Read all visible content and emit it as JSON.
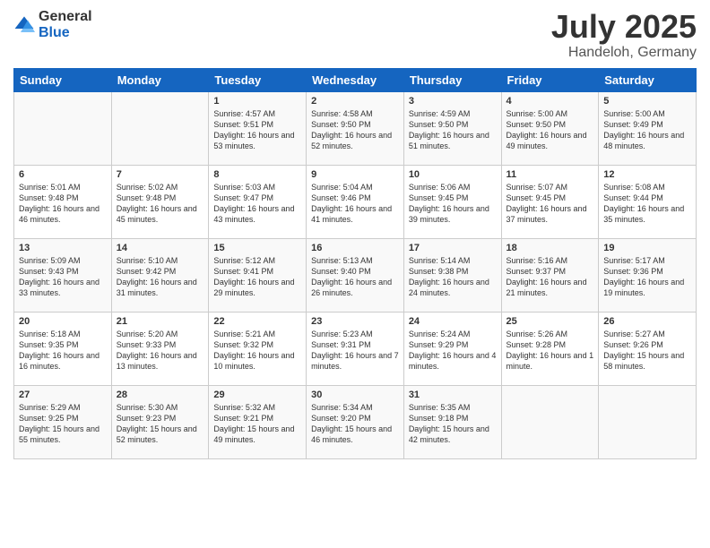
{
  "logo": {
    "general": "General",
    "blue": "Blue"
  },
  "title": "July 2025",
  "location": "Handeloh, Germany",
  "days": [
    "Sunday",
    "Monday",
    "Tuesday",
    "Wednesday",
    "Thursday",
    "Friday",
    "Saturday"
  ],
  "weeks": [
    [
      {
        "day": "",
        "sunrise": "",
        "sunset": "",
        "daylight": ""
      },
      {
        "day": "",
        "sunrise": "",
        "sunset": "",
        "daylight": ""
      },
      {
        "day": "1",
        "sunrise": "Sunrise: 4:57 AM",
        "sunset": "Sunset: 9:51 PM",
        "daylight": "Daylight: 16 hours and 53 minutes."
      },
      {
        "day": "2",
        "sunrise": "Sunrise: 4:58 AM",
        "sunset": "Sunset: 9:50 PM",
        "daylight": "Daylight: 16 hours and 52 minutes."
      },
      {
        "day": "3",
        "sunrise": "Sunrise: 4:59 AM",
        "sunset": "Sunset: 9:50 PM",
        "daylight": "Daylight: 16 hours and 51 minutes."
      },
      {
        "day": "4",
        "sunrise": "Sunrise: 5:00 AM",
        "sunset": "Sunset: 9:50 PM",
        "daylight": "Daylight: 16 hours and 49 minutes."
      },
      {
        "day": "5",
        "sunrise": "Sunrise: 5:00 AM",
        "sunset": "Sunset: 9:49 PM",
        "daylight": "Daylight: 16 hours and 48 minutes."
      }
    ],
    [
      {
        "day": "6",
        "sunrise": "Sunrise: 5:01 AM",
        "sunset": "Sunset: 9:48 PM",
        "daylight": "Daylight: 16 hours and 46 minutes."
      },
      {
        "day": "7",
        "sunrise": "Sunrise: 5:02 AM",
        "sunset": "Sunset: 9:48 PM",
        "daylight": "Daylight: 16 hours and 45 minutes."
      },
      {
        "day": "8",
        "sunrise": "Sunrise: 5:03 AM",
        "sunset": "Sunset: 9:47 PM",
        "daylight": "Daylight: 16 hours and 43 minutes."
      },
      {
        "day": "9",
        "sunrise": "Sunrise: 5:04 AM",
        "sunset": "Sunset: 9:46 PM",
        "daylight": "Daylight: 16 hours and 41 minutes."
      },
      {
        "day": "10",
        "sunrise": "Sunrise: 5:06 AM",
        "sunset": "Sunset: 9:45 PM",
        "daylight": "Daylight: 16 hours and 39 minutes."
      },
      {
        "day": "11",
        "sunrise": "Sunrise: 5:07 AM",
        "sunset": "Sunset: 9:45 PM",
        "daylight": "Daylight: 16 hours and 37 minutes."
      },
      {
        "day": "12",
        "sunrise": "Sunrise: 5:08 AM",
        "sunset": "Sunset: 9:44 PM",
        "daylight": "Daylight: 16 hours and 35 minutes."
      }
    ],
    [
      {
        "day": "13",
        "sunrise": "Sunrise: 5:09 AM",
        "sunset": "Sunset: 9:43 PM",
        "daylight": "Daylight: 16 hours and 33 minutes."
      },
      {
        "day": "14",
        "sunrise": "Sunrise: 5:10 AM",
        "sunset": "Sunset: 9:42 PM",
        "daylight": "Daylight: 16 hours and 31 minutes."
      },
      {
        "day": "15",
        "sunrise": "Sunrise: 5:12 AM",
        "sunset": "Sunset: 9:41 PM",
        "daylight": "Daylight: 16 hours and 29 minutes."
      },
      {
        "day": "16",
        "sunrise": "Sunrise: 5:13 AM",
        "sunset": "Sunset: 9:40 PM",
        "daylight": "Daylight: 16 hours and 26 minutes."
      },
      {
        "day": "17",
        "sunrise": "Sunrise: 5:14 AM",
        "sunset": "Sunset: 9:38 PM",
        "daylight": "Daylight: 16 hours and 24 minutes."
      },
      {
        "day": "18",
        "sunrise": "Sunrise: 5:16 AM",
        "sunset": "Sunset: 9:37 PM",
        "daylight": "Daylight: 16 hours and 21 minutes."
      },
      {
        "day": "19",
        "sunrise": "Sunrise: 5:17 AM",
        "sunset": "Sunset: 9:36 PM",
        "daylight": "Daylight: 16 hours and 19 minutes."
      }
    ],
    [
      {
        "day": "20",
        "sunrise": "Sunrise: 5:18 AM",
        "sunset": "Sunset: 9:35 PM",
        "daylight": "Daylight: 16 hours and 16 minutes."
      },
      {
        "day": "21",
        "sunrise": "Sunrise: 5:20 AM",
        "sunset": "Sunset: 9:33 PM",
        "daylight": "Daylight: 16 hours and 13 minutes."
      },
      {
        "day": "22",
        "sunrise": "Sunrise: 5:21 AM",
        "sunset": "Sunset: 9:32 PM",
        "daylight": "Daylight: 16 hours and 10 minutes."
      },
      {
        "day": "23",
        "sunrise": "Sunrise: 5:23 AM",
        "sunset": "Sunset: 9:31 PM",
        "daylight": "Daylight: 16 hours and 7 minutes."
      },
      {
        "day": "24",
        "sunrise": "Sunrise: 5:24 AM",
        "sunset": "Sunset: 9:29 PM",
        "daylight": "Daylight: 16 hours and 4 minutes."
      },
      {
        "day": "25",
        "sunrise": "Sunrise: 5:26 AM",
        "sunset": "Sunset: 9:28 PM",
        "daylight": "Daylight: 16 hours and 1 minute."
      },
      {
        "day": "26",
        "sunrise": "Sunrise: 5:27 AM",
        "sunset": "Sunset: 9:26 PM",
        "daylight": "Daylight: 15 hours and 58 minutes."
      }
    ],
    [
      {
        "day": "27",
        "sunrise": "Sunrise: 5:29 AM",
        "sunset": "Sunset: 9:25 PM",
        "daylight": "Daylight: 15 hours and 55 minutes."
      },
      {
        "day": "28",
        "sunrise": "Sunrise: 5:30 AM",
        "sunset": "Sunset: 9:23 PM",
        "daylight": "Daylight: 15 hours and 52 minutes."
      },
      {
        "day": "29",
        "sunrise": "Sunrise: 5:32 AM",
        "sunset": "Sunset: 9:21 PM",
        "daylight": "Daylight: 15 hours and 49 minutes."
      },
      {
        "day": "30",
        "sunrise": "Sunrise: 5:34 AM",
        "sunset": "Sunset: 9:20 PM",
        "daylight": "Daylight: 15 hours and 46 minutes."
      },
      {
        "day": "31",
        "sunrise": "Sunrise: 5:35 AM",
        "sunset": "Sunset: 9:18 PM",
        "daylight": "Daylight: 15 hours and 42 minutes."
      },
      {
        "day": "",
        "sunrise": "",
        "sunset": "",
        "daylight": ""
      },
      {
        "day": "",
        "sunrise": "",
        "sunset": "",
        "daylight": ""
      }
    ]
  ]
}
